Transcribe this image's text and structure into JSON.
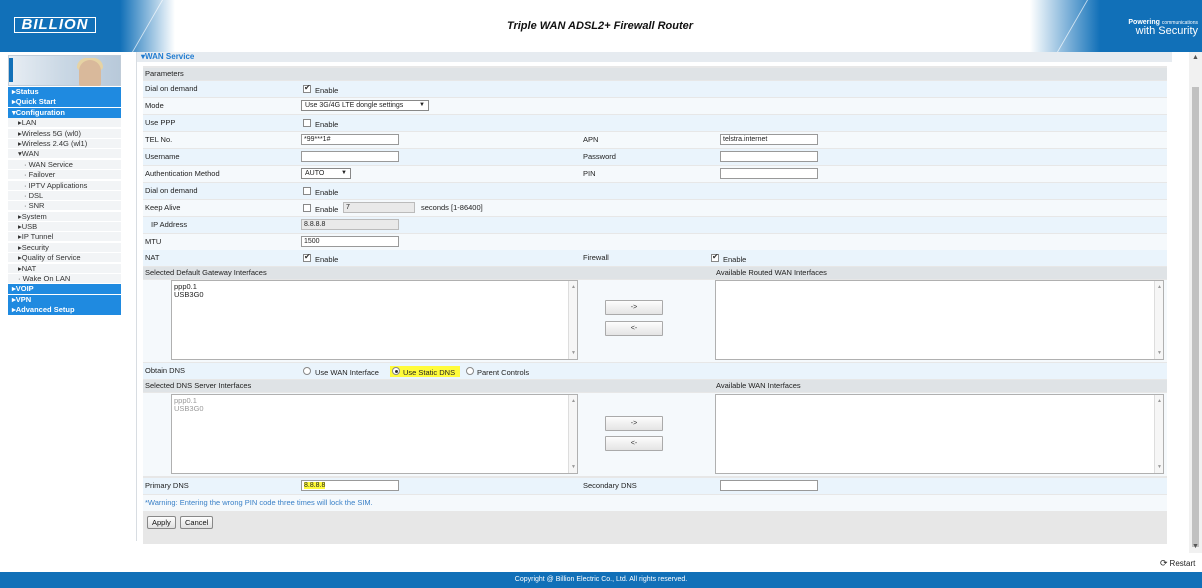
{
  "header": {
    "logo": "BILLION",
    "title": "Triple WAN ADSL2+ Firewall Router",
    "powering_line1": "Powering",
    "powering_line1_small": "communications",
    "powering_line2": "with Security"
  },
  "sidebar": {
    "items": [
      {
        "label": "▸Status",
        "level": "top"
      },
      {
        "label": "▸Quick Start",
        "level": "top"
      },
      {
        "label": "▾Configuration",
        "level": "top"
      },
      {
        "label": "▸LAN",
        "level": "sub"
      },
      {
        "label": "▸Wireless 5G (wl0)",
        "level": "sub"
      },
      {
        "label": "▸Wireless 2.4G (wl1)",
        "level": "sub"
      },
      {
        "label": "▾WAN",
        "level": "sub"
      },
      {
        "label": "· WAN Service",
        "level": "sub2"
      },
      {
        "label": "· Failover",
        "level": "sub2"
      },
      {
        "label": "· IPTV Applications",
        "level": "sub2"
      },
      {
        "label": "· DSL",
        "level": "sub2"
      },
      {
        "label": "· SNR",
        "level": "sub2"
      },
      {
        "label": "▸System",
        "level": "sub"
      },
      {
        "label": "▸USB",
        "level": "sub"
      },
      {
        "label": "▸IP Tunnel",
        "level": "sub"
      },
      {
        "label": "▸Security",
        "level": "sub"
      },
      {
        "label": "▸Quality of Service",
        "level": "sub"
      },
      {
        "label": "▸NAT",
        "level": "sub"
      },
      {
        "label": "· Wake On LAN",
        "level": "sub"
      },
      {
        "label": "▸VOIP",
        "level": "top"
      },
      {
        "label": "▸VPN",
        "level": "top"
      },
      {
        "label": "▸Advanced Setup",
        "level": "top"
      }
    ]
  },
  "main": {
    "section_title": "▾WAN Service",
    "parameters": "Parameters",
    "dial_on_demand_1": "Dial on demand",
    "enable": "Enable",
    "mode_label": "Mode",
    "mode_value": "Use 3G/4G LTE dongle settings",
    "use_ppp": "Use PPP",
    "tel_label": "TEL No.",
    "tel_value": "*99***1#",
    "apn_label": "APN",
    "apn_value": "telstra.internet",
    "username_label": "Username",
    "username_value": "",
    "password_label": "Password",
    "password_value": "",
    "auth_label": "Authentication Method",
    "auth_value": "AUTO",
    "pin_label": "PIN",
    "pin_value": "",
    "dial_on_demand_2": "Dial on demand",
    "keep_alive": "Keep Alive",
    "keep_alive_value": "7",
    "keep_alive_unit": "seconds [1-86400]",
    "ip_label": "IP Address",
    "ip_value": "8.8.8.8",
    "mtu_label": "MTU",
    "mtu_value": "1500",
    "nat_label": "NAT",
    "firewall_label": "Firewall",
    "sel_gw_label": "Selected Default Gateway Interfaces",
    "avail_routed_label": "Available Routed WAN Interfaces",
    "gw_list": [
      "ppp0.1",
      "USB3G0"
    ],
    "arrow_right": "->",
    "arrow_left": "<-",
    "obtain_dns": "Obtain DNS",
    "dns_opt1": "Use WAN Interface",
    "dns_opt2": "Use Static DNS",
    "dns_opt3": "Parent Controls",
    "sel_dns_label": "Selected DNS Server Interfaces",
    "avail_wan_label": "Available WAN Interfaces",
    "dns_list": [
      "ppp0.1",
      "USB3G0"
    ],
    "primary_dns_label": "Primary DNS",
    "primary_dns_value": "8.8.8.8",
    "secondary_dns_label": "Secondary DNS",
    "secondary_dns_value": "",
    "warning": "*Warning: Entering the wrong PIN code three times will lock the SIM.",
    "apply": "Apply",
    "cancel": "Cancel"
  },
  "restart": "Restart",
  "footer": "Copyright @ Billion Electric Co., Ltd. All rights reserved.",
  "colors": {
    "brand_blue": "#1170b8",
    "menu_blue": "#1f8ae0",
    "highlight": "#fffb3a"
  }
}
